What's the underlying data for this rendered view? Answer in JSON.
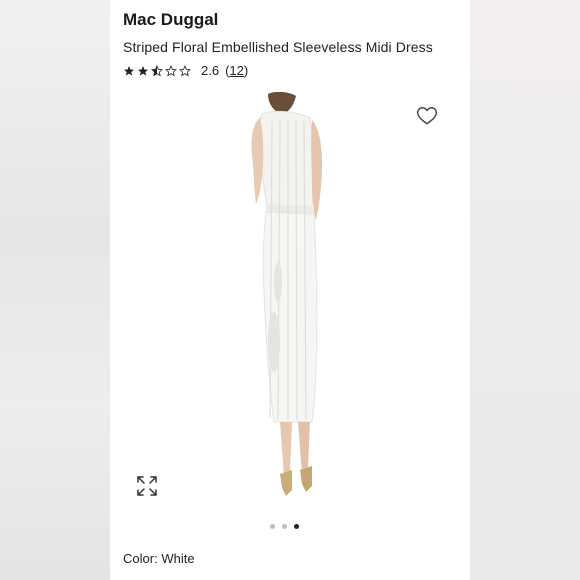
{
  "product": {
    "brand": "Mac Duggal",
    "title": "Striped Floral Embellished Sleeveless Midi Dress",
    "rating": {
      "value": "2.6",
      "stars_filled": 2.5,
      "stars_total": 5,
      "count_open": "(",
      "count": "12",
      "count_close": ")"
    },
    "color_label": "Color:",
    "color_value": "White"
  },
  "gallery": {
    "image_count": 3,
    "active_index": 2
  },
  "icons": {
    "wishlist": "heart-outline-icon",
    "expand": "expand-arrows-icon",
    "star": "star-icon"
  },
  "colors": {
    "text": "#222222",
    "dot_inactive": "#bdbdbd",
    "dot_active": "#222222"
  }
}
